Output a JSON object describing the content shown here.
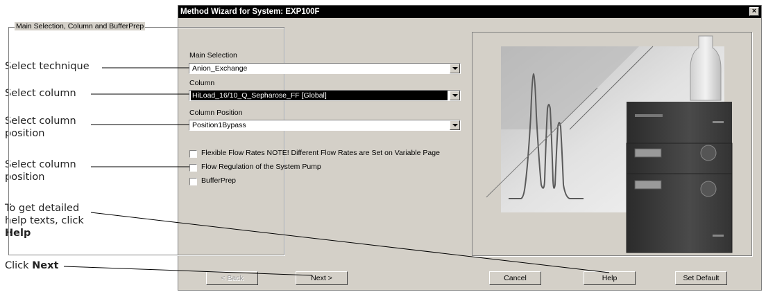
{
  "callouts": {
    "technique": "Select technique",
    "column": "Select column",
    "column_position_1": "Select column",
    "column_position_2": "position",
    "flow_1": "Select column",
    "flow_2": "position",
    "help_1": "To get detailed",
    "help_2": "help texts, click",
    "help_3": "Help",
    "next_1": "Click ",
    "next_2": "Next"
  },
  "window": {
    "title": "Method Wizard for System: EXP100F",
    "close_glyph": "×"
  },
  "group": {
    "title": "Main Selection, Column and BufferPrep",
    "main_selection_label": "Main Selection",
    "main_selection_value": "Anion_Exchange",
    "column_label": "Column",
    "column_value": "HiLoad_16/10_Q_Sepharose_FF [Global]",
    "column_position_label": "Column Position",
    "column_position_value": "Position1Bypass",
    "checkboxes": [
      {
        "label": "Flexible Flow Rates   NOTE! Different Flow Rates are Set on Variable Page",
        "checked": false
      },
      {
        "label": "Flow Regulation of the System Pump",
        "checked": false
      },
      {
        "label": "BufferPrep",
        "checked": false
      }
    ]
  },
  "buttons": {
    "back": "< Back",
    "next": "Next >",
    "cancel": "Cancel",
    "help": "Help",
    "set_default": "Set Default"
  }
}
